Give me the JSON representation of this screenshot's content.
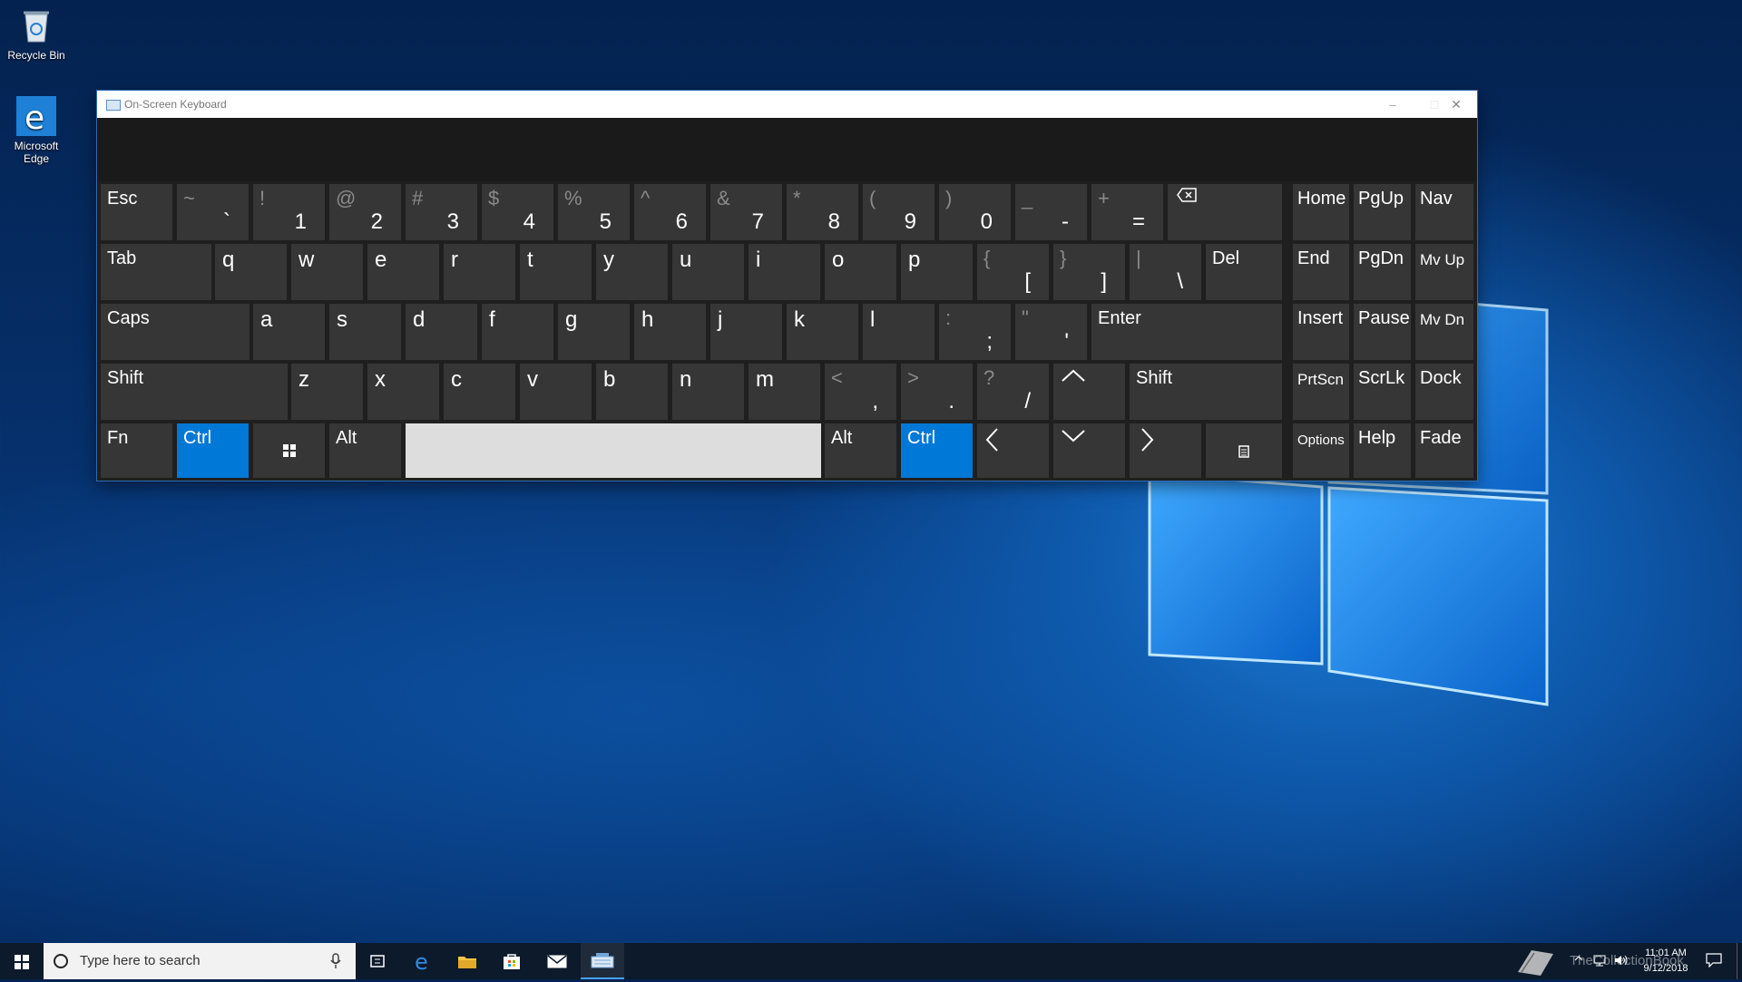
{
  "desktop": {
    "recycle_bin_label": "Recycle Bin",
    "edge_label_1": "Microsoft",
    "edge_label_2": "Edge"
  },
  "window": {
    "title": "On-Screen Keyboard",
    "minimize": "–",
    "maximize": "□",
    "close": "✕"
  },
  "keys": {
    "esc": "Esc",
    "tilde_top": "~",
    "tilde_main": "`",
    "k1_top": "!",
    "k1_main": "1",
    "k2_top": "@",
    "k2_main": "2",
    "k3_top": "#",
    "k3_main": "3",
    "k4_top": "$",
    "k4_main": "4",
    "k5_top": "%",
    "k5_main": "5",
    "k6_top": "^",
    "k6_main": "6",
    "k7_top": "&",
    "k7_main": "7",
    "k8_top": "*",
    "k8_main": "8",
    "k9_top": "(",
    "k9_main": "9",
    "k0_top": ")",
    "k0_main": "0",
    "minus_top": "_",
    "minus_main": "-",
    "equal_top": "+",
    "equal_main": "=",
    "tab": "Tab",
    "q": "q",
    "w": "w",
    "e": "e",
    "r": "r",
    "t": "t",
    "y": "y",
    "u": "u",
    "i": "i",
    "o": "o",
    "p": "p",
    "lbracket_top": "{",
    "lbracket_main": "[",
    "rbracket_top": "}",
    "rbracket_main": "]",
    "backslash_top": "|",
    "backslash_main": "\\",
    "del": "Del",
    "caps": "Caps",
    "a": "a",
    "s": "s",
    "d": "d",
    "f": "f",
    "g": "g",
    "h": "h",
    "j": "j",
    "k": "k",
    "l": "l",
    "semicolon_top": ":",
    "semicolon_main": ";",
    "quote_top": "\"",
    "quote_main": "'",
    "enter": "Enter",
    "shift_left": "Shift",
    "z": "z",
    "x": "x",
    "c": "c",
    "v": "v",
    "b": "b",
    "n": "n",
    "m": "m",
    "comma_top": "<",
    "comma_main": ",",
    "period_top": ">",
    "period_main": ".",
    "slash_top": "?",
    "slash_main": "/",
    "shift_right": "Shift",
    "fn": "Fn",
    "ctrl_left": "Ctrl",
    "alt_left": "Alt",
    "alt_right": "Alt",
    "ctrl_right": "Ctrl",
    "home": "Home",
    "pgup": "PgUp",
    "nav": "Nav",
    "end": "End",
    "pgdn": "PgDn",
    "mvup": "Mv Up",
    "insert": "Insert",
    "pause": "Pause",
    "mvdn": "Mv Dn",
    "prtscn": "PrtScn",
    "scrlk": "ScrLk",
    "dock": "Dock",
    "options": "Options",
    "help": "Help",
    "fade": "Fade"
  },
  "taskbar": {
    "search_placeholder": "Type here to search",
    "time": "11:01 AM",
    "date": "9/12/2018",
    "watermark": "TheCollectionBook"
  },
  "colors": {
    "accent": "#0078d7",
    "key_bg": "#363636",
    "osk_bg": "#1f1f1f"
  }
}
